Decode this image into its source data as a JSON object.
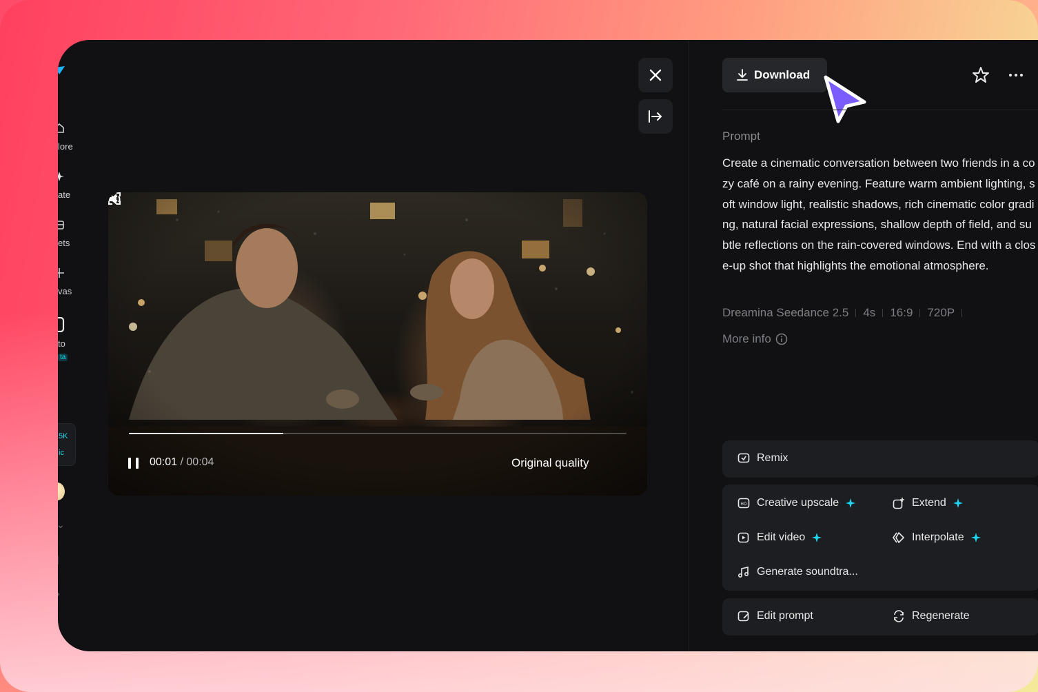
{
  "sidebar": {
    "items": [
      {
        "label": "lore",
        "icon": "home-icon"
      },
      {
        "label": "ate",
        "icon": "sparkle-icon"
      },
      {
        "label": "ets",
        "icon": "assets-icon"
      },
      {
        "label": "vas",
        "icon": "canvas-icon"
      },
      {
        "label": "to",
        "icon": "photo-icon"
      }
    ],
    "beta_badge": "ta",
    "card_lines": [
      "5K",
      "ic"
    ]
  },
  "player": {
    "current_time": "00:01",
    "duration": "/ 00:04",
    "progress": 0.31,
    "quality_label": "Original quality"
  },
  "header": {
    "download_label": "Download"
  },
  "prompt": {
    "label": "Prompt",
    "text": "Create a cinematic conversation between two friends in a cozy café on a rainy evening. Feature warm ambient lighting, soft window light, realistic shadows, rich cinematic color grading, natural facial expressions, shallow depth of field, and subtle reflections on the rain-covered windows. End with a close-up shot that highlights the emotional atmosphere."
  },
  "meta": {
    "model": "Dreamina Seedance 2.5",
    "duration": "4s",
    "ratio": "16:9",
    "resolution": "720P"
  },
  "more_info_label": "More info",
  "actions": {
    "remix": "Remix",
    "creative_upscale": "Creative upscale",
    "extend": "Extend",
    "edit_video": "Edit video",
    "interpolate": "Interpolate",
    "generate_soundtrack": "Generate soundtra...",
    "edit_prompt": "Edit prompt",
    "regenerate": "Regenerate"
  },
  "colors": {
    "accent_spark": "#1ed6f0",
    "cursor": "#7b5cff",
    "panel_bg": "#111113"
  }
}
